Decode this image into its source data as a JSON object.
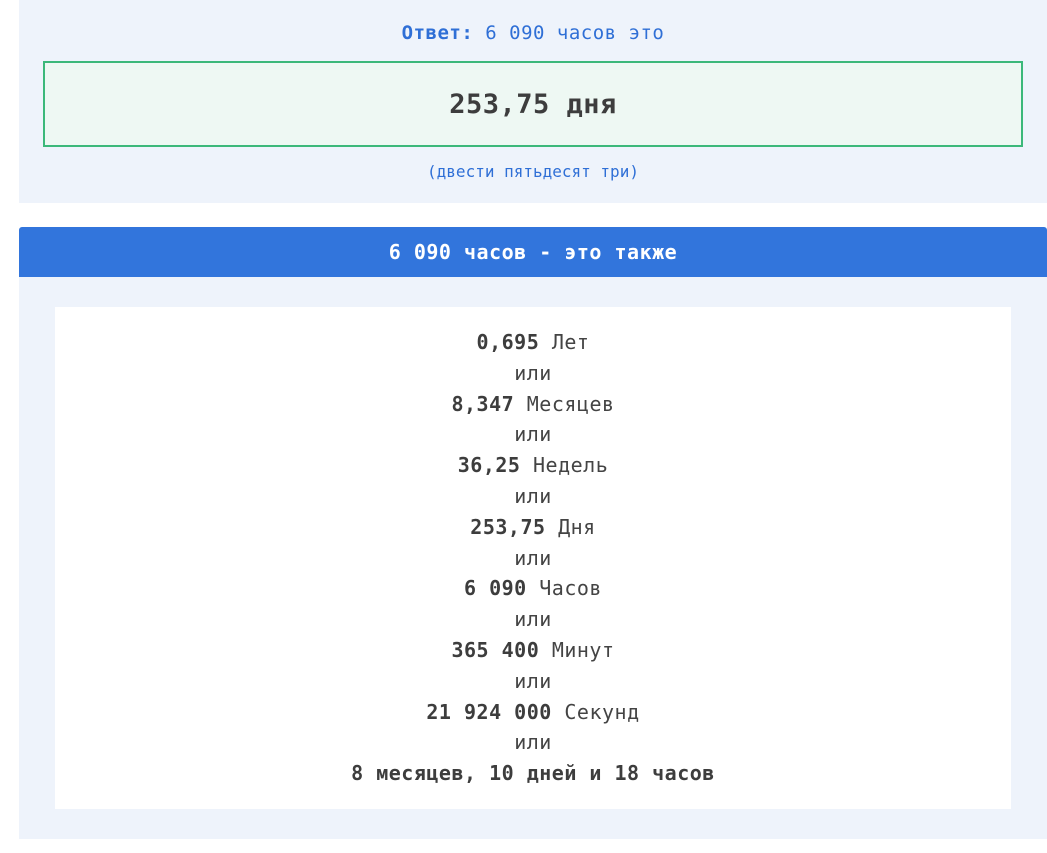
{
  "answer": {
    "label": "Ответ:",
    "text": "6 090 часов это",
    "result": "253,75 дня",
    "words": "(двести пятьдесят три)"
  },
  "also": {
    "header": "6 090 часов - это также",
    "or_word": "или",
    "items": [
      {
        "value": "0,695",
        "unit": "Лет"
      },
      {
        "value": "8,347",
        "unit": "Месяцев"
      },
      {
        "value": "36,25",
        "unit": "Недель"
      },
      {
        "value": "253,75",
        "unit": "Дня"
      },
      {
        "value": "6 090",
        "unit": "Часов"
      },
      {
        "value": "365 400",
        "unit": "Минут"
      },
      {
        "value": "21 924 000",
        "unit": "Секунд"
      }
    ],
    "summary": "8 месяцев, 10 дней и 18 часов"
  }
}
